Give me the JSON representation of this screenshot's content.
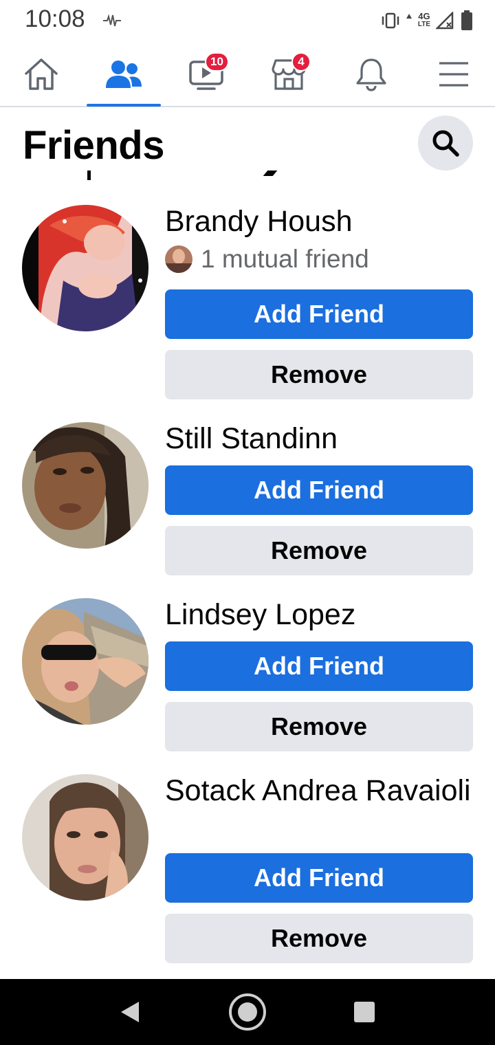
{
  "status_bar": {
    "time": "10:08",
    "network": "4G",
    "network_sub": "LTE",
    "icons": [
      "vibrate-icon",
      "data-arrows-icon",
      "signal-icon",
      "battery-icon",
      "activity-wave-icon"
    ]
  },
  "nav": {
    "items": [
      {
        "name": "home",
        "icon": "home-icon"
      },
      {
        "name": "friends",
        "icon": "friends-icon",
        "active": true
      },
      {
        "name": "watch",
        "icon": "video-icon",
        "badge": "10"
      },
      {
        "name": "marketplace",
        "icon": "store-icon",
        "badge": "4"
      },
      {
        "name": "notifications",
        "icon": "bell-icon"
      },
      {
        "name": "menu",
        "icon": "hamburger-icon"
      }
    ],
    "accent": "#1b74e4",
    "badge_color": "#e41e3f"
  },
  "header": {
    "title": "Friends",
    "search_icon": "search-icon"
  },
  "requests": [
    {
      "name": "Brandy Housh",
      "mutual": "1 mutual friend",
      "add_label": "Add Friend",
      "remove_label": "Remove"
    },
    {
      "name": "Still Standinn",
      "add_label": "Add Friend",
      "remove_label": "Remove"
    },
    {
      "name": "Lindsey Lopez",
      "add_label": "Add Friend",
      "remove_label": "Remove"
    },
    {
      "name": "Sotack Andrea Ravaioli",
      "add_label": "Add Friend",
      "remove_label": "Remove"
    }
  ],
  "colors": {
    "primary_button": "#1b6fde",
    "secondary_button": "#e4e6eb",
    "secondary_text": "#65676b"
  },
  "android_nav": {
    "icons": [
      "back-icon",
      "home-circle-icon",
      "recents-icon"
    ]
  }
}
